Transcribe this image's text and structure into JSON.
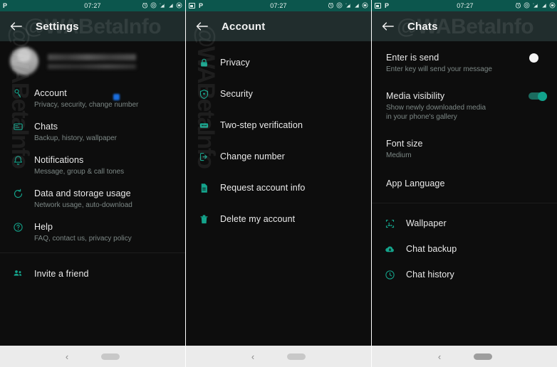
{
  "statusbar": {
    "time": "07:27",
    "left_icons_screen1": [
      "p-badge"
    ],
    "left_icons_other": [
      "screenshot-icon",
      "p-badge"
    ],
    "p_label": "P",
    "right_icons": [
      "alarm-icon",
      "nfc-icon",
      "mobile-data-icon",
      "signal-icon",
      "battery-icon"
    ],
    "bar_color": "#0c564d"
  },
  "watermark": {
    "text": "@WABetaInfo"
  },
  "accent_color": "#12a28c",
  "screens": [
    {
      "id": "settings",
      "title": "Settings",
      "profile": {
        "redacted": true
      },
      "items": [
        {
          "icon": "key-icon",
          "title": "Account",
          "subtitle": "Privacy, security, change number"
        },
        {
          "icon": "chat-icon",
          "title": "Chats",
          "subtitle": "Backup, history, wallpaper"
        },
        {
          "icon": "bell-icon",
          "title": "Notifications",
          "subtitle": "Message, group & call tones"
        },
        {
          "icon": "data-icon",
          "title": "Data and storage usage",
          "subtitle": "Network usage, auto-download"
        },
        {
          "icon": "help-icon",
          "title": "Help",
          "subtitle": "FAQ, contact us, privacy policy"
        }
      ],
      "footer_items": [
        {
          "icon": "people-icon",
          "title": "Invite a friend",
          "subtitle": ""
        }
      ]
    },
    {
      "id": "account",
      "title": "Account",
      "items": [
        {
          "icon": "lock-icon",
          "title": "Privacy"
        },
        {
          "icon": "shield-icon",
          "title": "Security"
        },
        {
          "icon": "dots-icon",
          "title": "Two-step verification"
        },
        {
          "icon": "sim-swap-icon",
          "title": "Change number"
        },
        {
          "icon": "document-icon",
          "title": "Request account info"
        },
        {
          "icon": "trash-icon",
          "title": "Delete my account"
        }
      ]
    },
    {
      "id": "chats",
      "title": "Chats",
      "items": [
        {
          "type": "toggle",
          "title": "Enter is send",
          "subtitle": "Enter key will send your message",
          "value": "off"
        },
        {
          "type": "toggle",
          "title": "Media visibility",
          "subtitle": "Show newly downloaded media in your phone's gallery",
          "value": "on"
        },
        {
          "type": "value",
          "title": "Font size",
          "subtitle": "Medium"
        },
        {
          "type": "plain",
          "title": "App Language",
          "subtitle": ""
        }
      ],
      "footer_items": [
        {
          "icon": "wallpaper-icon",
          "title": "Wallpaper"
        },
        {
          "icon": "cloud-icon",
          "title": "Chat backup"
        },
        {
          "icon": "history-icon",
          "title": "Chat history"
        }
      ]
    }
  ],
  "navbar": {
    "back": "‹"
  }
}
